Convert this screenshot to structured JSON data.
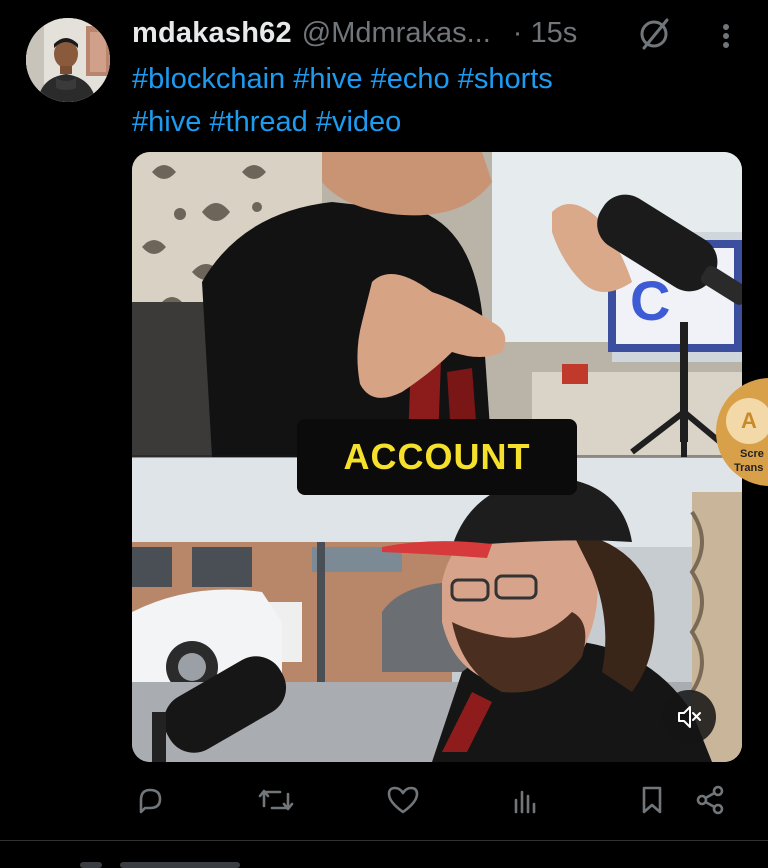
{
  "post": {
    "display_name": "mdakash62",
    "handle": "@Mdmrakas...",
    "timestamp": "· 15s",
    "text_line1": [
      "#blockchain",
      "#hive",
      "#echo",
      "#shorts"
    ],
    "text_line2": [
      "#hive",
      "#thread",
      "#video"
    ]
  },
  "media": {
    "caption": "ACCOUNT",
    "top_screen_text": "C"
  },
  "translate_badge": {
    "letter": "A",
    "line1": "Scre",
    "line2": "Trans"
  },
  "actions": [
    "reply-icon",
    "repost-icon",
    "like-icon",
    "views-icon",
    "bookmark-icon",
    "share-icon"
  ],
  "colors": {
    "background": "#000000",
    "primary_text": "#e7e9ea",
    "secondary_text": "#71767b",
    "link": "#1d9bf0",
    "caption": "#f5e02b"
  }
}
